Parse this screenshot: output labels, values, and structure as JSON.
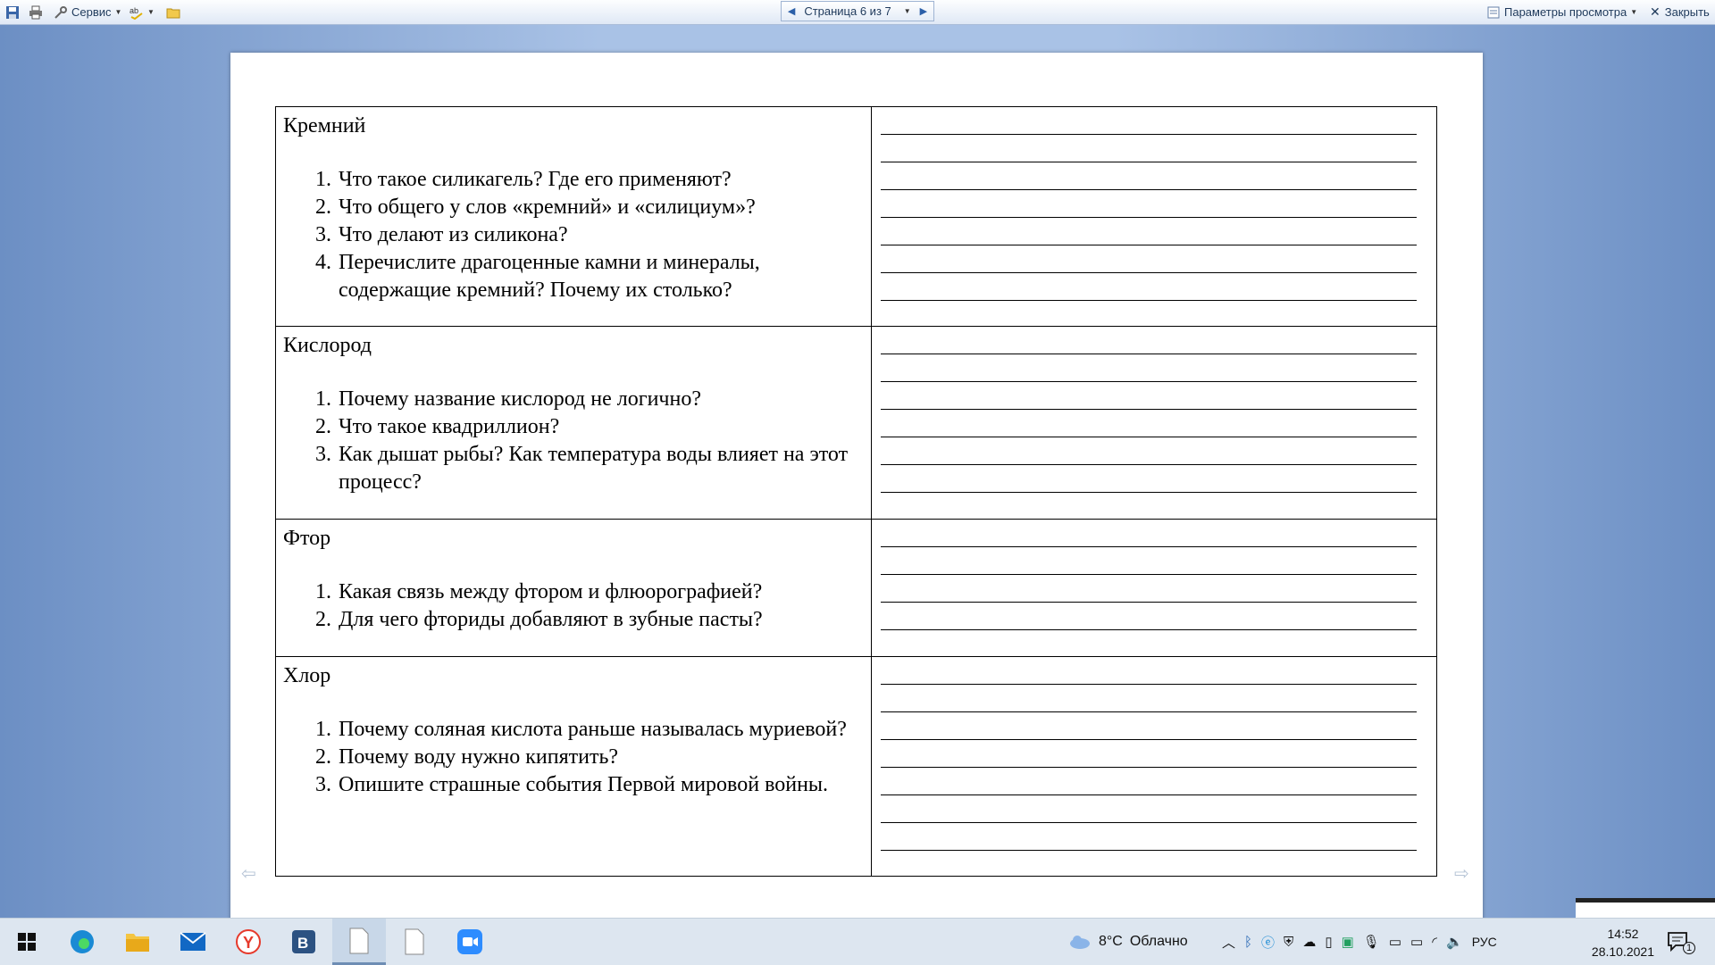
{
  "toolbar": {
    "service_label": "Сервис",
    "page_indicator": "Страница 6 из 7",
    "view_options_label": "Параметры просмотра",
    "close_label": "Закрыть"
  },
  "document": {
    "sections": [
      {
        "title": "Кремний",
        "questions": [
          "Что такое силикагель? Где его применяют?",
          "Что общего у слов «кремний» и «силициум»?",
          "Что делают из силикона?",
          "Перечислите драгоценные камни и минералы, содержащие кремний? Почему их столько?"
        ],
        "answer_lines": 7
      },
      {
        "title": "Кислород",
        "questions": [
          "Почему название кислород не логично?",
          "Что такое квадриллион?",
          "Как дышат рыбы? Как температура воды влияет на этот процесс?"
        ],
        "answer_lines": 6
      },
      {
        "title": "Фтор",
        "questions": [
          "Какая связь между фтором и флюорографией?",
          "Для чего фториды добавляют в зубные пасты?"
        ],
        "answer_lines": 4
      },
      {
        "title": "Хлор",
        "questions": [
          "Почему соляная кислота раньше называлась муриевой?",
          "Почему воду нужно кипятить?",
          "Опишите страшные события Первой мировой войны."
        ],
        "answer_lines": 7
      }
    ]
  },
  "taskbar": {
    "weather_temp": "8°C",
    "weather_text": "Облачно",
    "language": "РУС",
    "time": "14:52",
    "date": "28.10.2021",
    "notification_count": "1"
  },
  "colors": {
    "accent": "#2b5fa8",
    "workspace": "#a9c2e6",
    "taskbar": "#dde6f0"
  }
}
